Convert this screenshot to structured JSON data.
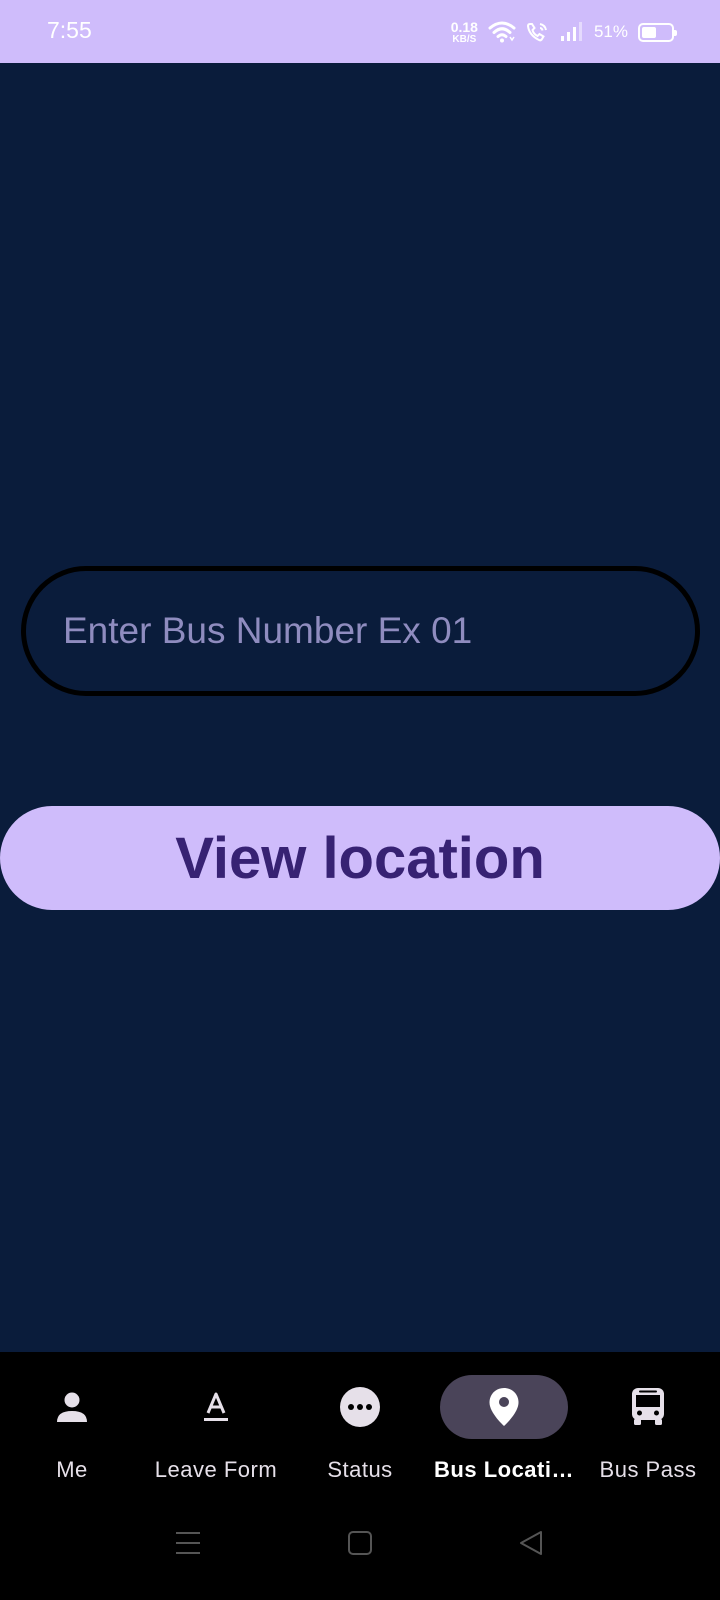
{
  "status_bar": {
    "time": "7:55",
    "net_speed_value": "0.18",
    "net_speed_unit": "KB/S",
    "battery_percent": "51%",
    "battery_level": 0.51,
    "background": "#cfbcfb"
  },
  "main": {
    "background": "#0a1c3b",
    "bus_input_placeholder": "Enter Bus Number Ex 01",
    "bus_input_value": "",
    "view_button_label": "View location"
  },
  "bottom_nav": {
    "active_index": 3,
    "items": [
      {
        "label": "Me",
        "icon": "person-icon"
      },
      {
        "label": "Leave Form",
        "icon": "text-format-icon"
      },
      {
        "label": "Status",
        "icon": "more-horiz-circle-icon"
      },
      {
        "label": "Bus Locati…",
        "icon": "location-pin-icon"
      },
      {
        "label": "Bus Pass",
        "icon": "bus-icon"
      }
    ]
  },
  "colors": {
    "accent": "#cfbcfb",
    "accent_text": "#372273",
    "nav_active_pill": "#4a4459"
  }
}
